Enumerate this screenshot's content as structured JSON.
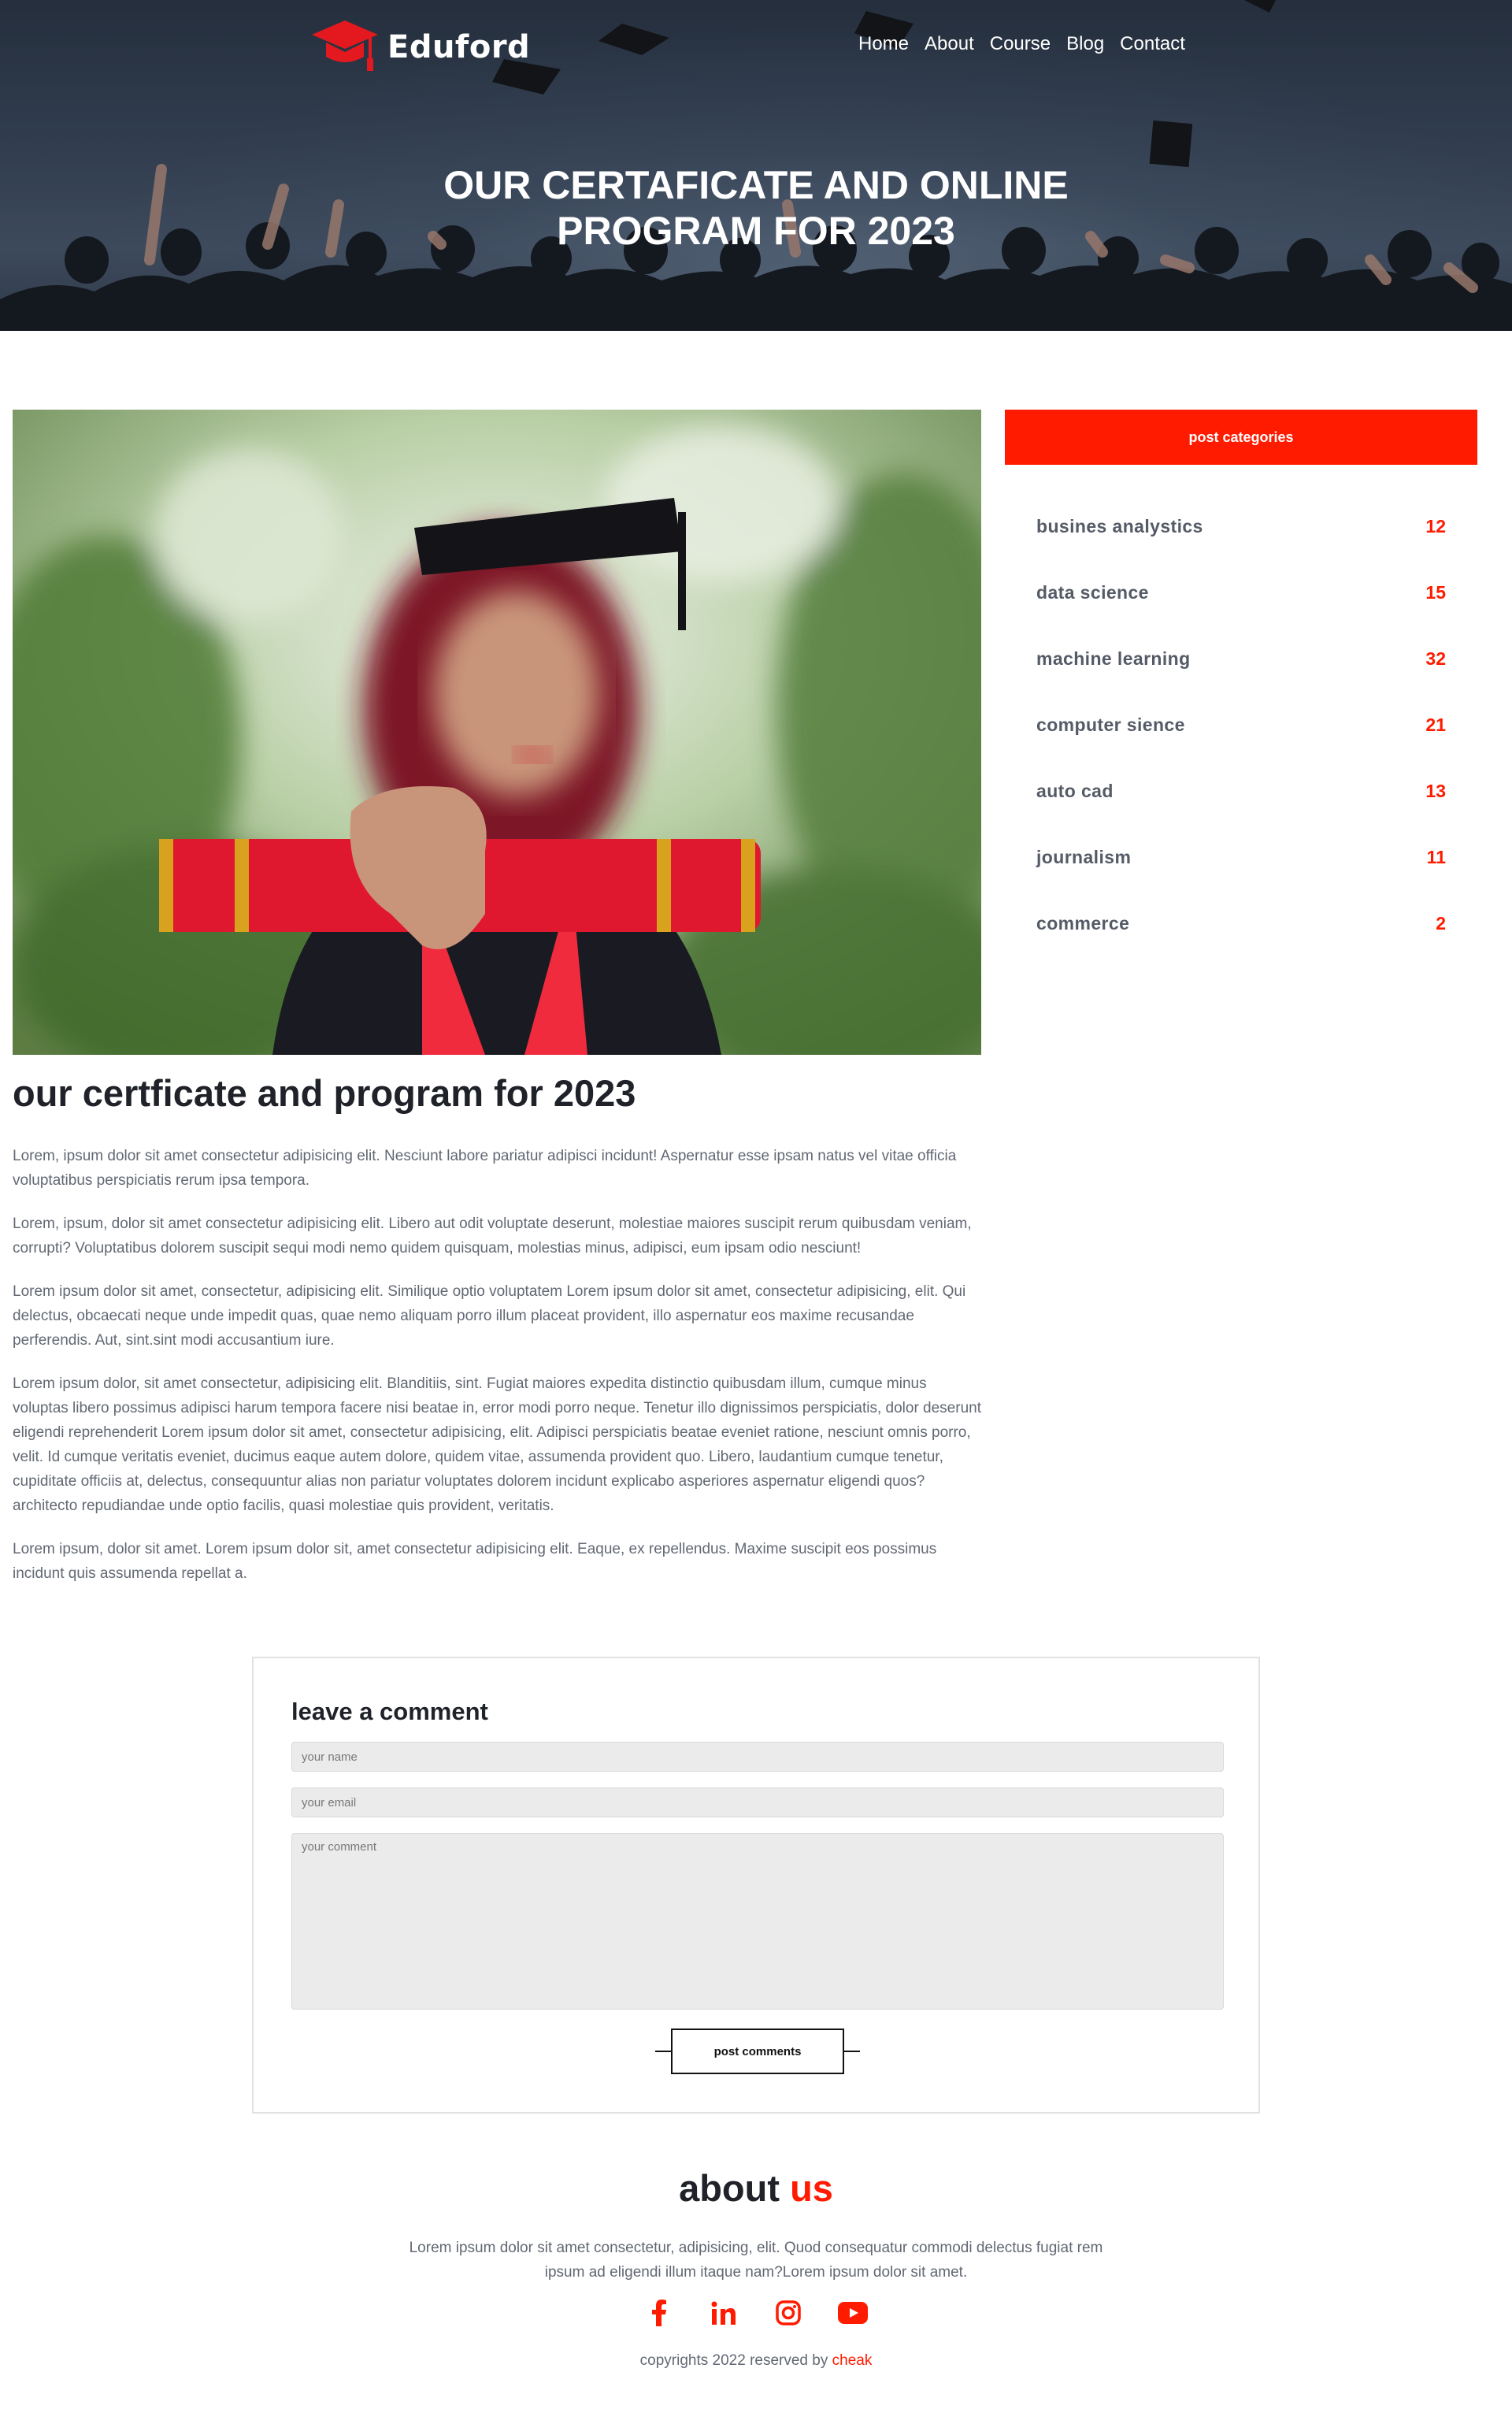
{
  "brand": {
    "name": "Eduford"
  },
  "nav": {
    "items": [
      "Home",
      "About",
      "Course",
      "Blog",
      "Contact"
    ]
  },
  "hero": {
    "title_line1": "OUR CERTAFICATE AND ONLINE",
    "title_line2": "PROGRAM FOR 2023"
  },
  "post": {
    "title": "our certficate and program for 2023",
    "paragraphs": [
      "Lorem, ipsum dolor sit amet consectetur adipisicing elit. Nesciunt labore pariatur adipisci incidunt! Aspernatur esse ipsam natus vel vitae officia voluptatibus perspiciatis rerum ipsa tempora.",
      "Lorem, ipsum, dolor sit amet consectetur adipisicing elit. Libero aut odit voluptate deserunt, molestiae maiores suscipit rerum quibusdam veniam, corrupti? Voluptatibus dolorem suscipit sequi modi nemo quidem quisquam, molestias minus, adipisci, eum ipsam odio nesciunt!",
      "Lorem ipsum dolor sit amet, consectetur, adipisicing elit. Similique optio voluptatem Lorem ipsum dolor sit amet, consectetur adipisicing, elit. Qui delectus, obcaecati neque unde impedit quas, quae nemo aliquam porro illum placeat provident, illo aspernatur eos maxime recusandae perferendis. Aut, sint.sint modi accusantium iure.",
      "Lorem ipsum dolor, sit amet consectetur, adipisicing elit. Blanditiis, sint. Fugiat maiores expedita distinctio quibusdam illum, cumque minus voluptas libero possimus adipisci harum tempora facere nisi beatae in, error modi porro neque. Tenetur illo dignissimos perspiciatis, dolor deserunt eligendi reprehenderit Lorem ipsum dolor sit amet, consectetur adipisicing, elit. Adipisci perspiciatis beatae eveniet ratione, nesciunt omnis porro, velit. Id cumque veritatis eveniet, ducimus eaque autem dolore, quidem vitae, assumenda provident quo. Libero, laudantium cumque tenetur, cupiditate officiis at, delectus, consequuntur alias non pariatur voluptates dolorem incidunt explicabo asperiores aspernatur eligendi quos?architecto repudiandae unde optio facilis, quasi molestiae quis provident, veritatis.",
      "Lorem ipsum, dolor sit amet. Lorem ipsum dolor sit, amet consectetur adipisicing elit. Eaque, ex repellendus. Maxime suscipit eos possimus incidunt quis assumenda repellat a."
    ]
  },
  "sidebar": {
    "header": "post categories",
    "categories": [
      {
        "name": "busines analystics",
        "count": "12"
      },
      {
        "name": "data science",
        "count": "15"
      },
      {
        "name": "machine learning",
        "count": "32"
      },
      {
        "name": "computer sience",
        "count": "21"
      },
      {
        "name": "auto cad",
        "count": "13"
      },
      {
        "name": "journalism",
        "count": "11"
      },
      {
        "name": "commerce",
        "count": "2"
      }
    ]
  },
  "comment_form": {
    "title": "leave a comment",
    "name_placeholder": "your name",
    "email_placeholder": "your email",
    "comment_placeholder": "your comment",
    "submit_label": "post comments"
  },
  "about": {
    "title_main": "about",
    "title_accent": "us",
    "text": "Lorem ipsum dolor sit amet consectetur, adipisicing, elit. Quod consequatur commodi delectus fugiat rem ipsum ad eligendi illum itaque nam?Lorem ipsum dolor sit amet."
  },
  "socials": [
    "facebook-icon",
    "linkedin-icon",
    "instagram-icon",
    "youtube-icon"
  ],
  "footer": {
    "copyright_prefix": "copyrights 2022 reserved by",
    "copyright_brand": "cheak"
  },
  "colors": {
    "accent": "#ff1b00",
    "heading": "#1f2229",
    "text": "#626873"
  }
}
